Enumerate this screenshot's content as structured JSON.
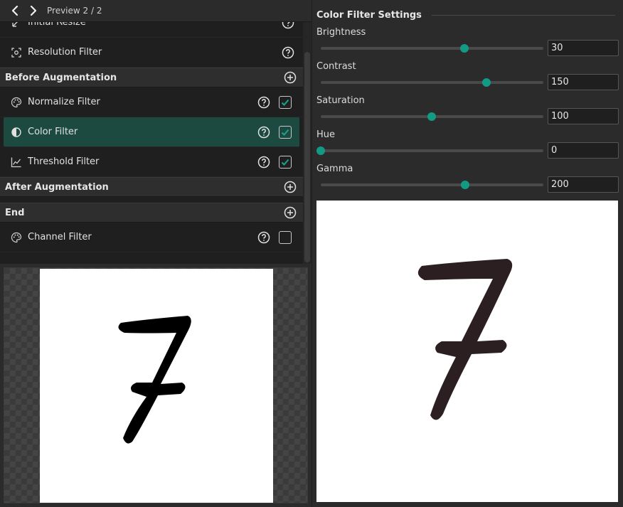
{
  "topbar": {
    "preview_label": "Preview 2 / 2"
  },
  "pipeline": {
    "partial_item": {
      "label": "Initial Resize",
      "icon": "resize-icon"
    },
    "resolution_item": {
      "label": "Resolution Filter",
      "icon": "resolution-icon"
    },
    "sections": [
      {
        "title": "Before Augmentation",
        "items": [
          {
            "label": "Normalize Filter",
            "icon": "palette-icon",
            "checked": true
          },
          {
            "label": "Color Filter",
            "icon": "contrast-icon",
            "checked": true,
            "selected": true
          },
          {
            "label": "Threshold Filter",
            "icon": "line-chart-icon",
            "checked": true
          }
        ]
      },
      {
        "title": "After Augmentation",
        "items": []
      },
      {
        "title": "End",
        "items": [
          {
            "label": "Channel Filter",
            "icon": "palette-icon",
            "checked": false
          }
        ]
      }
    ]
  },
  "settings": {
    "title": "Color Filter Settings",
    "params": [
      {
        "name": "Brightness",
        "value": "30",
        "fill": 0.645
      },
      {
        "name": "Contrast",
        "value": "150",
        "fill": 0.746
      },
      {
        "name": "Saturation",
        "value": "100",
        "fill": 0.498
      },
      {
        "name": "Hue",
        "value": "0",
        "fill": 0.0
      },
      {
        "name": "Gamma",
        "value": "200",
        "fill": 0.65
      }
    ]
  },
  "previews": {
    "left_digit": "7",
    "right_digit": "7"
  },
  "colors": {
    "accent": "#139a85",
    "selected_row": "#1c4a41",
    "check": "#17a58e"
  }
}
